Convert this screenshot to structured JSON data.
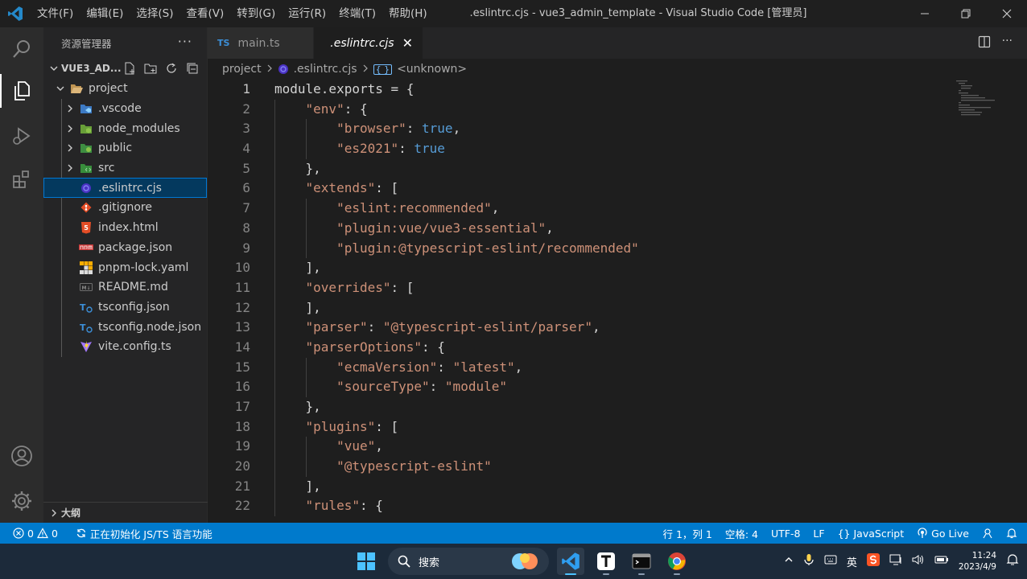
{
  "window": {
    "title": ".eslintrc.cjs - vue3_admin_template - Visual Studio Code [管理员]",
    "menu": [
      "文件(F)",
      "编辑(E)",
      "选择(S)",
      "查看(V)",
      "转到(G)",
      "运行(R)",
      "终端(T)",
      "帮助(H)"
    ]
  },
  "sidebar": {
    "header": "资源管理器",
    "folder_name": "VUE3_AD...",
    "tree": [
      {
        "label": "project",
        "kind": "folder-open",
        "depth": 0
      },
      {
        "label": ".vscode",
        "kind": "folder",
        "depth": 1,
        "icon": "vscode-folder-icon"
      },
      {
        "label": "node_modules",
        "kind": "folder",
        "depth": 1,
        "icon": "node-folder-icon"
      },
      {
        "label": "public",
        "kind": "folder",
        "depth": 1,
        "icon": "public-folder-icon"
      },
      {
        "label": "src",
        "kind": "folder",
        "depth": 1,
        "icon": "src-folder-icon"
      },
      {
        "label": ".eslintrc.cjs",
        "kind": "file",
        "depth": 1,
        "icon": "eslint-icon",
        "selected": true
      },
      {
        "label": ".gitignore",
        "kind": "file",
        "depth": 1,
        "icon": "git-icon"
      },
      {
        "label": "index.html",
        "kind": "file",
        "depth": 1,
        "icon": "html-icon"
      },
      {
        "label": "package.json",
        "kind": "file",
        "depth": 1,
        "icon": "npm-icon"
      },
      {
        "label": "pnpm-lock.yaml",
        "kind": "file",
        "depth": 1,
        "icon": "pnpm-icon"
      },
      {
        "label": "README.md",
        "kind": "file",
        "depth": 1,
        "icon": "markdown-icon"
      },
      {
        "label": "tsconfig.json",
        "kind": "file",
        "depth": 1,
        "icon": "tsconfig-icon"
      },
      {
        "label": "tsconfig.node.json",
        "kind": "file",
        "depth": 1,
        "icon": "tsconfig-icon"
      },
      {
        "label": "vite.config.ts",
        "kind": "file",
        "depth": 1,
        "icon": "vite-icon"
      }
    ],
    "outline_label": "大纲"
  },
  "editor": {
    "tabs": [
      {
        "label": "main.ts",
        "badge": "TS",
        "active": false
      },
      {
        "label": ".eslintrc.cjs",
        "active": true
      }
    ],
    "breadcrumb": [
      "project",
      ".eslintrc.cjs",
      "<unknown>"
    ],
    "current_line": 1,
    "lines": [
      "module.exports = {",
      "    \"env\": {",
      "        \"browser\": true,",
      "        \"es2021\": true",
      "    },",
      "    \"extends\": [",
      "        \"eslint:recommended\",",
      "        \"plugin:vue/vue3-essential\",",
      "        \"plugin:@typescript-eslint/recommended\"",
      "    ],",
      "    \"overrides\": [",
      "    ],",
      "    \"parser\": \"@typescript-eslint/parser\",",
      "    \"parserOptions\": {",
      "        \"ecmaVersion\": \"latest\",",
      "        \"sourceType\": \"module\"",
      "    },",
      "    \"plugins\": [",
      "        \"vue\",",
      "        \"@typescript-eslint\"",
      "    ],",
      "    \"rules\": {"
    ]
  },
  "statusbar": {
    "errors": "0",
    "warnings": "0",
    "task": "正在初始化 JS/TS 语言功能",
    "position": "行 1，列 1",
    "spaces": "空格: 4",
    "encoding": "UTF-8",
    "eol": "LF",
    "language": "JavaScript",
    "golive": "Go Live"
  },
  "taskbar": {
    "search_label": "搜索",
    "ime": "英",
    "time": "11:24",
    "date": "2023/4/9"
  },
  "colors": {
    "accent": "#007acc",
    "string": "#ce9178",
    "keyword": "#569cd6",
    "selection": "#04395e"
  }
}
